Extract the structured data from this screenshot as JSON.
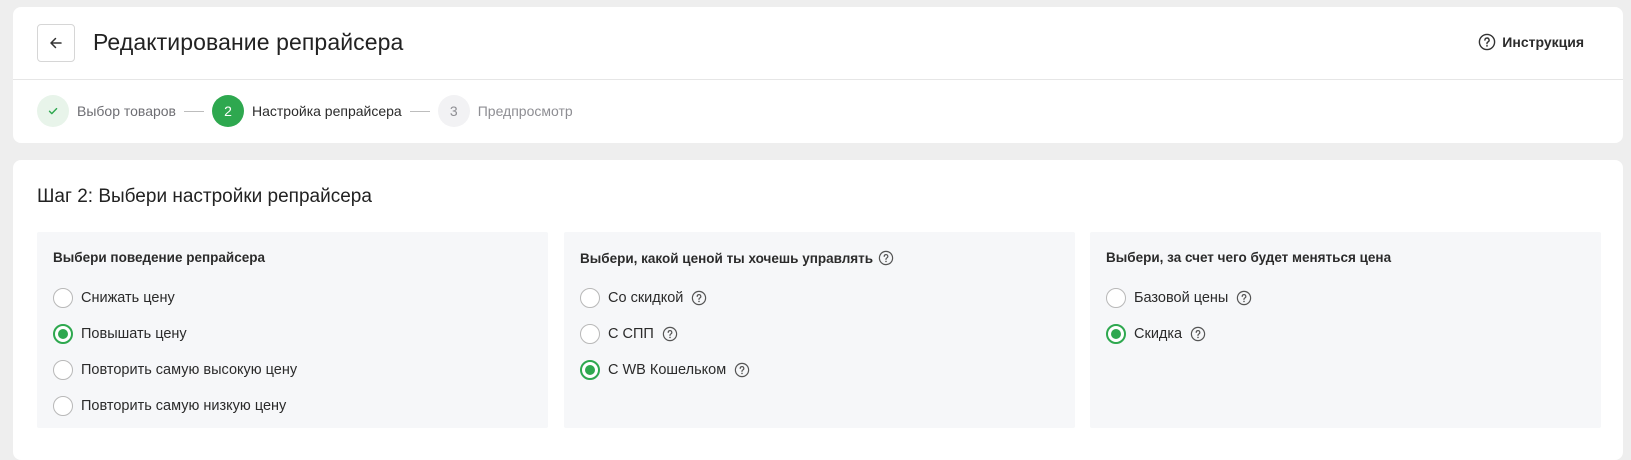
{
  "header": {
    "title": "Редактирование репрайсера",
    "help_label": "Инструкция"
  },
  "stepper": {
    "steps": [
      {
        "number": "",
        "label": "Выбор товаров",
        "state": "done"
      },
      {
        "number": "2",
        "label": "Настройка репрайсера",
        "state": "active"
      },
      {
        "number": "3",
        "label": "Предпросмотр",
        "state": "todo"
      }
    ]
  },
  "main": {
    "section_title": "Шаг 2: Выбери настройки репрайсера",
    "panels": [
      {
        "title": "Выбери поведение репрайсера",
        "options": [
          {
            "label": "Снижать цену",
            "checked": false
          },
          {
            "label": "Повышать цену",
            "checked": true
          },
          {
            "label": "Повторить самую высокую цену",
            "checked": false
          },
          {
            "label": "Повторить самую низкую цену",
            "checked": false
          }
        ]
      },
      {
        "title": "Выбери, какой ценой ты хочешь управлять",
        "options": [
          {
            "label": "Со скидкой",
            "checked": false
          },
          {
            "label": "С СПП",
            "checked": false
          },
          {
            "label": "С WB Кошельком",
            "checked": true
          }
        ]
      },
      {
        "title": "Выбери, за счет чего будет меняться цена",
        "options": [
          {
            "label": "Базовой цены",
            "checked": false
          },
          {
            "label": "Скидка",
            "checked": true
          }
        ]
      }
    ]
  },
  "colors": {
    "accent": "#2ea84f",
    "page_bg": "#eeeeee",
    "panel_bg": "#f6f7f9"
  }
}
